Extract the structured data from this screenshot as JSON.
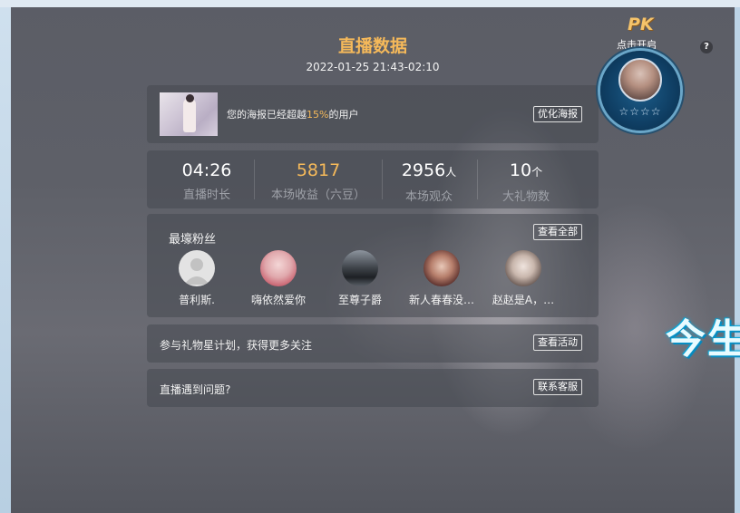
{
  "colors": {
    "accent": "#f5b95a",
    "panel_bg": "#464850",
    "muted_label": "#9ea1a8"
  },
  "header": {
    "title": "直播数据",
    "time_range": "2022-01-25 21:43-02:10"
  },
  "poster": {
    "text_before": "您的海报已经超越",
    "percent": "15%",
    "text_after": "的用户",
    "button_label": "优化海报"
  },
  "stats": [
    {
      "value": "04:26",
      "unit": "",
      "label": "直播时长"
    },
    {
      "value": "5817",
      "unit": "",
      "label": "本场收益（六豆）"
    },
    {
      "value": "2956",
      "unit": "人",
      "label": "本场观众"
    },
    {
      "value": "10",
      "unit": "个",
      "label": "大礼物数"
    }
  ],
  "fans": {
    "title": "最壕粉丝",
    "view_all_label": "查看全部",
    "items": [
      {
        "name": "普利斯."
      },
      {
        "name": "嗨依然爱你"
      },
      {
        "name": "至尊子爵"
      },
      {
        "name": "新人春春没…"
      },
      {
        "name": "赵赵是A，…"
      }
    ]
  },
  "gift_plan": {
    "text": "参与礼物星计划，获得更多关注",
    "button_label": "查看活动"
  },
  "support": {
    "text": "直播遇到问题?",
    "button_label": "联系客服"
  },
  "pk_widget": {
    "logo": "PK",
    "subtitle": "点击开启",
    "stars": "☆☆☆☆"
  },
  "help": {
    "label": "?"
  },
  "side_banner": {
    "text": "今生"
  }
}
